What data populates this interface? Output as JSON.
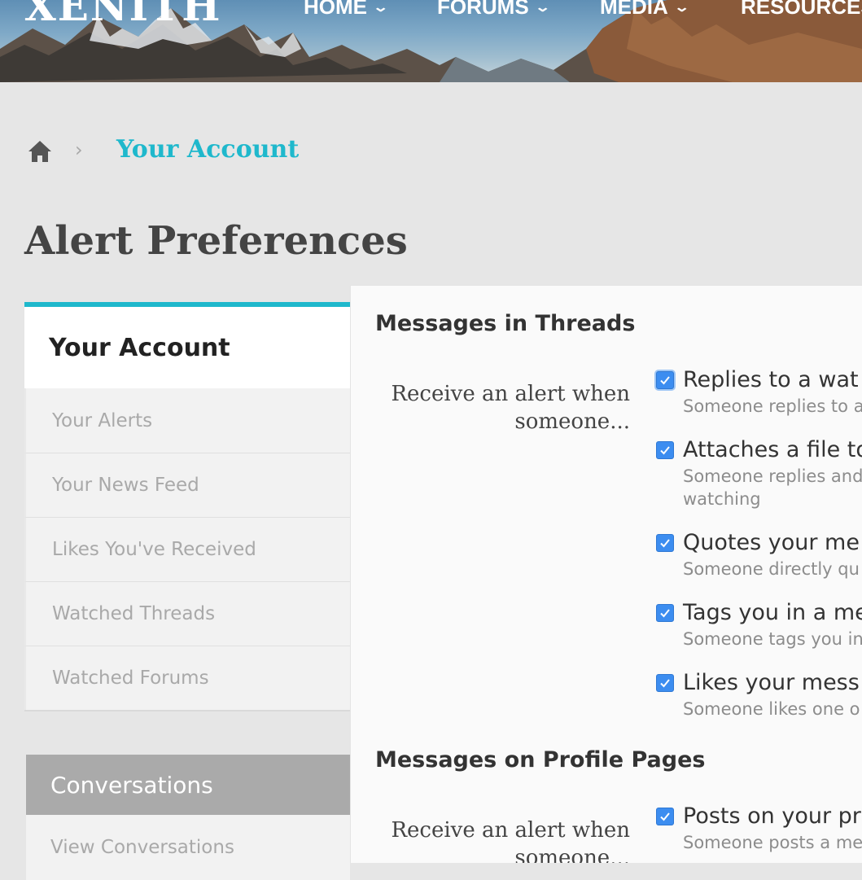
{
  "header": {
    "logo": "XENITH",
    "nav": [
      {
        "label": "HOME",
        "chevron": "⌄"
      },
      {
        "label": "FORUMS",
        "chevron": "⌄"
      },
      {
        "label": "MEDIA",
        "chevron": "⌄"
      },
      {
        "label": "RESOURCES"
      }
    ]
  },
  "breadcrumb": {
    "home_icon": "home-icon",
    "separator": "›",
    "current": "Your Account"
  },
  "page_title": "Alert Preferences",
  "sidebar": {
    "accent_color": "#1fb8cc",
    "heading": "Your Account",
    "items": [
      {
        "label": "Your Alerts"
      },
      {
        "label": "Your News Feed"
      },
      {
        "label": "Likes You've Received"
      },
      {
        "label": "Watched Threads"
      },
      {
        "label": "Watched Forums"
      }
    ],
    "conversations": {
      "heading": "Conversations",
      "items": [
        {
          "label": "View Conversations"
        }
      ]
    }
  },
  "main": {
    "sections": [
      {
        "title": "Messages in Threads",
        "receive_label_line1": "Receive an alert when",
        "receive_label_line2": "someone...",
        "options": [
          {
            "label": "Replies to a wat",
            "desc": "Someone replies to a",
            "checked": true,
            "focused": true
          },
          {
            "label": "Attaches a file to",
            "desc": "Someone replies and",
            "desc2": "watching",
            "checked": true
          },
          {
            "label": "Quotes your me",
            "desc": "Someone directly qu",
            "checked": true
          },
          {
            "label": "Tags you in a me",
            "desc": "Someone tags you in",
            "checked": true
          },
          {
            "label": "Likes your mess",
            "desc": "Someone likes one o",
            "checked": true
          }
        ]
      },
      {
        "title": "Messages on Profile Pages",
        "receive_label_line1": "Receive an alert when",
        "receive_label_line2": "someone...",
        "options": [
          {
            "label": "Posts on your pr",
            "desc": "Someone posts a me",
            "checked": true
          }
        ]
      }
    ]
  }
}
